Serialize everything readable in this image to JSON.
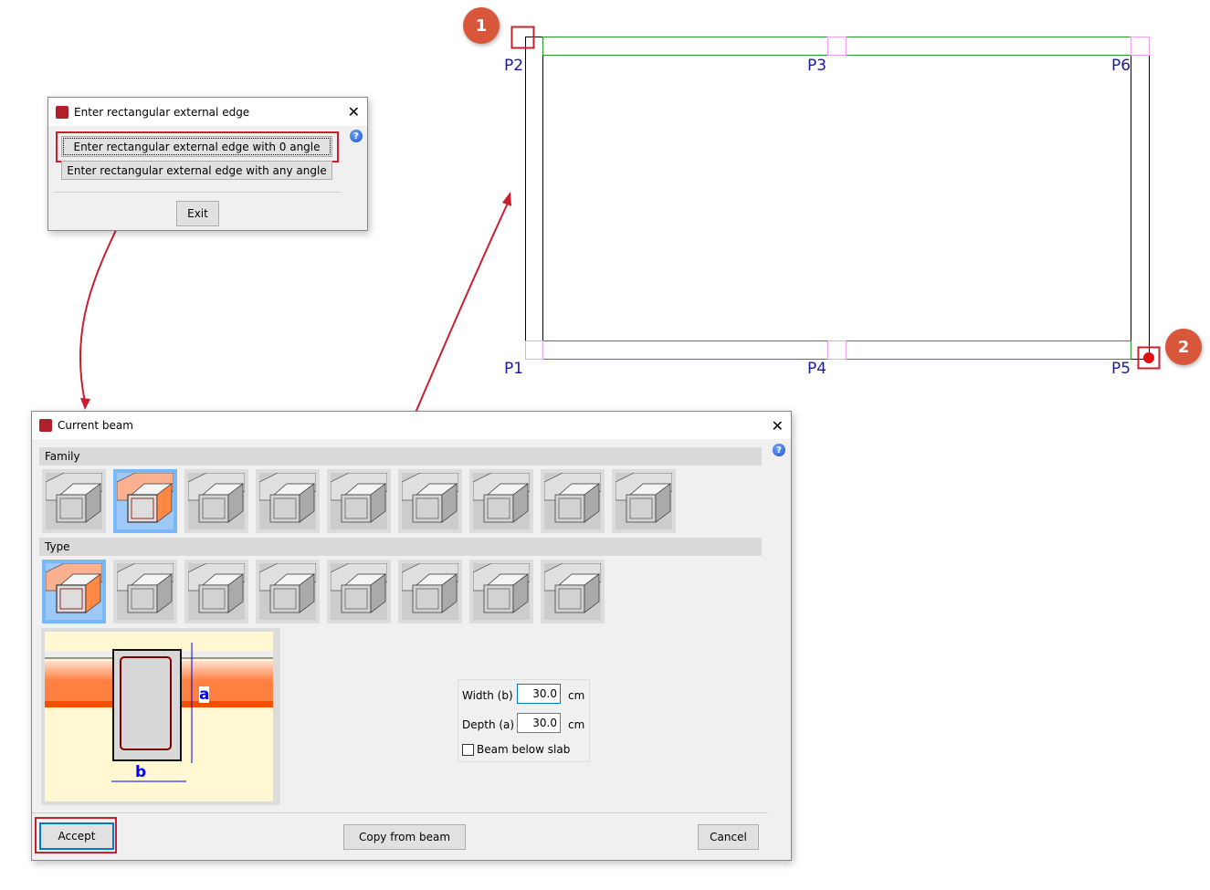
{
  "dialog_edge": {
    "title": "Enter rectangular external edge",
    "btn_zero": "Enter rectangular external edge with 0 angle",
    "btn_any": "Enter rectangular external edge with any angle",
    "exit": "Exit",
    "help": "?",
    "close": "✕"
  },
  "dialog_beam": {
    "title": "Current beam",
    "close": "✕",
    "help": "?",
    "family_label": "Family",
    "type_label": "Type",
    "family_count": 9,
    "family_selected": 1,
    "type_count": 8,
    "type_selected": 0,
    "diagram": {
      "a": "a",
      "b": "b"
    },
    "width_label": "Width (b)",
    "width_value": "30.0",
    "width_unit": "cm",
    "depth_label": "Depth (a)",
    "depth_value": "30.0",
    "depth_unit": "cm",
    "below_slab_label": "Beam below slab",
    "below_slab_checked": false,
    "accept": "Accept",
    "copy": "Copy from beam",
    "cancel": "Cancel"
  },
  "drawing": {
    "points": {
      "p1": "P1",
      "p2": "P2",
      "p3": "P3",
      "p4": "P4",
      "p5": "P5",
      "p6": "P6"
    },
    "step1": "1",
    "step2": "2"
  },
  "colors": {
    "accent": "#c8202e",
    "badge": "#d8573a",
    "beam": "#2a9a2a",
    "label": "#1a1aa0"
  }
}
